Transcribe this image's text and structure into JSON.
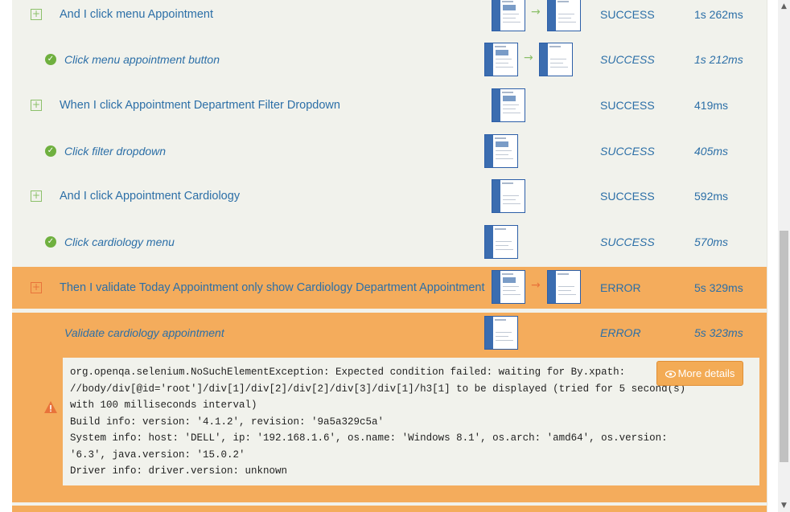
{
  "steps": [
    {
      "title": "And I click menu Appointment",
      "status": "SUCCESS",
      "duration": "1s 262ms"
    },
    {
      "title": "Click menu appointment button",
      "status": "SUCCESS",
      "duration": "1s 212ms"
    },
    {
      "title": "When I click Appointment Department Filter Dropdown",
      "status": "SUCCESS",
      "duration": "419ms"
    },
    {
      "title": "Click filter dropdown",
      "status": "SUCCESS",
      "duration": "405ms"
    },
    {
      "title": "And I click Appointment Cardiology",
      "status": "SUCCESS",
      "duration": "592ms"
    },
    {
      "title": "Click cardiology menu",
      "status": "SUCCESS",
      "duration": "570ms"
    },
    {
      "title": "Then I validate Today Appointment only show Cardiology Department Appointment",
      "status": "ERROR",
      "duration": "5s 329ms"
    },
    {
      "title": "Validate cardiology appointment",
      "status": "ERROR",
      "duration": "5s 323ms"
    }
  ],
  "error": {
    "text": "org.openqa.selenium.NoSuchElementException: Expected condition failed: waiting for By.xpath:\n//body/div[@id='root']/div[1]/div[2]/div[2]/div[3]/div[1]/h3[1] to be displayed (tried for 5 second(s)\nwith 100 milliseconds interval)\nBuild info: version: '4.1.2', revision: '9a5a329c5a'\nSystem info: host: 'DELL', ip: '192.168.1.6', os.name: 'Windows 8.1', os.arch: 'amd64', os.version:\n'6.3', java.version: '15.0.2'\nDriver info: driver.version: unknown",
    "more_details_label": "More details"
  },
  "icons": {
    "expand": "plus-square-icon",
    "success": "check-circle-icon",
    "warning": "warning-triangle-icon",
    "eye": "eye-icon",
    "arrow": "arrow-right-icon"
  },
  "colors": {
    "panel": "#f1f2ec",
    "error_row": "#f4ac5c",
    "link": "#2c6fa7",
    "success": "#6fb03f",
    "error_icon": "#e8733a"
  }
}
